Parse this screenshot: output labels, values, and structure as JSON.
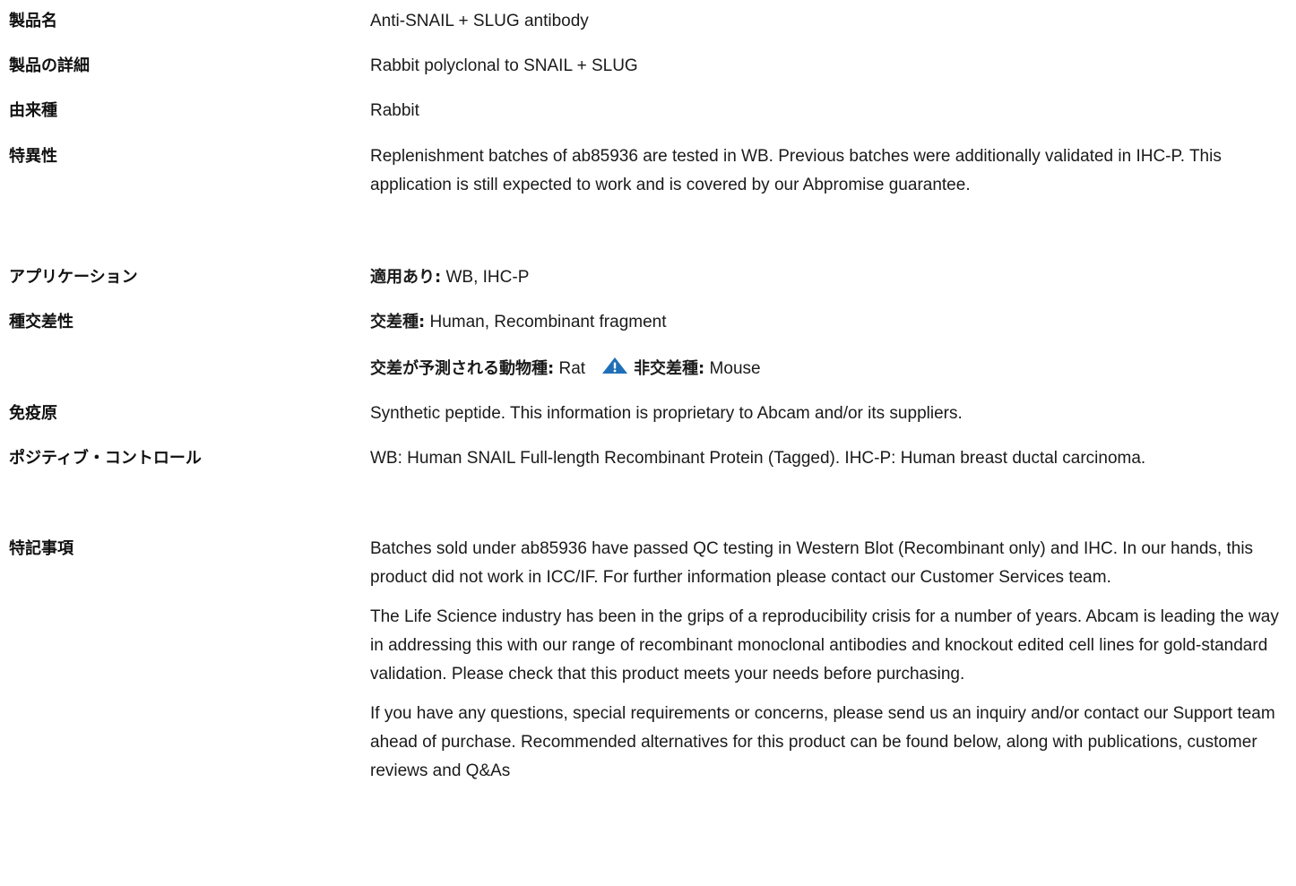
{
  "rows": [
    {
      "label": "製品名",
      "value": "Anti-SNAIL + SLUG antibody"
    },
    {
      "label": "製品の詳細",
      "value": "Rabbit polyclonal to SNAIL + SLUG"
    },
    {
      "label": "由来種",
      "value": "Rabbit"
    },
    {
      "label": "特異性",
      "value": "Replenishment batches of ab85936 are tested in WB. Previous batches were additionally validated in IHC-P. This application is still expected to work and is covered by our Abpromise guarantee."
    },
    {
      "label": "アプリケーション",
      "prefix": "適用あり:",
      "value": " WB, IHC-P"
    },
    {
      "label": "種交差性",
      "reactive_prefix": "交差種:",
      "reactive_value": " Human, Recombinant fragment",
      "predicted_prefix": "交差が予測される動物種:",
      "predicted_value": " Rat",
      "non_prefix": "非交差種:",
      "non_value": " Mouse"
    },
    {
      "label": "免疫原",
      "value": "Synthetic peptide. This information is proprietary to Abcam and/or its suppliers."
    },
    {
      "label": "ポジティブ・コントロール",
      "value": "WB: Human SNAIL Full-length Recombinant Protein (Tagged). IHC-P: Human breast ductal carcinoma."
    },
    {
      "label": "特記事項",
      "paragraphs": [
        "Batches sold under ab85936 have passed QC testing in Western Blot (Recombinant only) and IHC. In our hands, this product did not work in ICC/IF. For further information please contact our Customer Services team.",
        "The Life Science industry has been in the grips of a reproducibility crisis for a number of years. Abcam is leading the way in addressing this with our range of recombinant monoclonal antibodies and knockout edited cell lines for gold-standard validation. Please check that this product meets your needs before purchasing.",
        "If you have any questions, special requirements or concerns, please send us an inquiry and/or contact our Support team ahead of purchase. Recommended alternatives for this product can be found below, along with publications, customer reviews and Q&As"
      ]
    }
  ],
  "icons": {
    "warning": "warning-triangle-icon",
    "warning_color": "#1f6fb8"
  }
}
